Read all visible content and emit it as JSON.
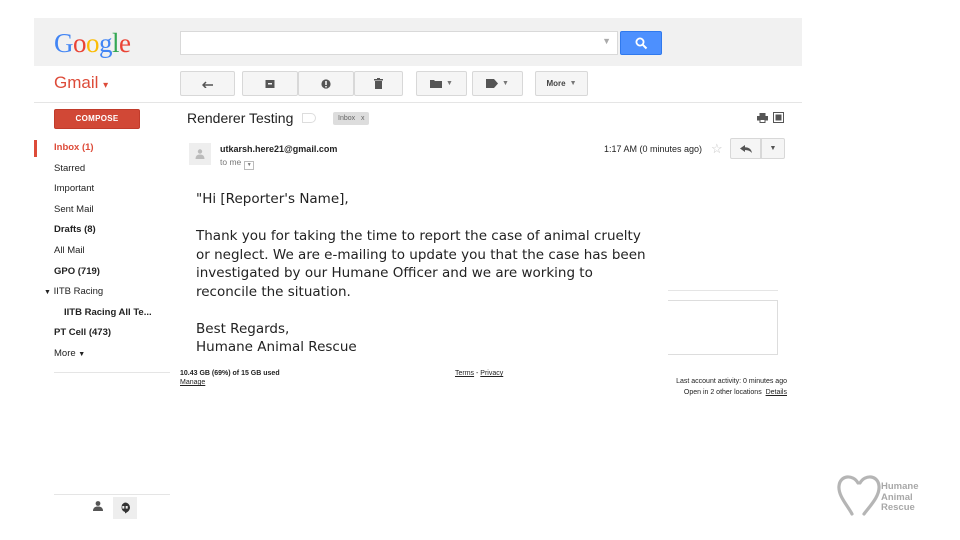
{
  "header": {
    "logo_letters": [
      "G",
      "o",
      "o",
      "g",
      "l",
      "e"
    ],
    "search": {
      "value": "",
      "placeholder": ""
    }
  },
  "app_label": "Gmail",
  "toolbar": {
    "more_label": "More"
  },
  "compose_label": "COMPOSE",
  "nav_items": [
    {
      "label": "Inbox (1)"
    },
    {
      "label": "Starred"
    },
    {
      "label": "Important"
    },
    {
      "label": "Sent Mail"
    },
    {
      "label": "Drafts (8)"
    },
    {
      "label": "All Mail"
    },
    {
      "label": "GPO (719)"
    },
    {
      "label": "IITB Racing"
    },
    {
      "label": "IITB Racing All Te..."
    },
    {
      "label": "PT Cell (473)"
    },
    {
      "label": "More"
    }
  ],
  "message": {
    "subject": "Renderer Testing",
    "label_chip": "Inbox",
    "label_chip_close": "x",
    "sender": "utkarsh.here21@gmail.com",
    "recipient": "to me",
    "time": "1:17 AM (0 minutes ago)",
    "body": {
      "greeting": "\"Hi [Reporter's Name],",
      "paragraph": "Thank you for taking the time to report the case of animal cruelty\nor neglect. We are e-mailing to update you that the case has been\ninvestigated by our Humane Officer and we are working to\nreconcile the situation.",
      "closing": "Best Regards,",
      "signature": "Humane Animal Rescue"
    }
  },
  "footer": {
    "storage": "10.43 GB (69%) of 15 GB used",
    "manage": "Manage",
    "terms": "Terms",
    "separator": " - ",
    "privacy": "Privacy",
    "activity": "Last account activity: 0 minutes ago",
    "open_locations": "Open in 2 other locations",
    "details": "Details"
  },
  "brand_logo": {
    "line1": "Humane",
    "line2": "Animal",
    "line3": "Rescue"
  },
  "colors": {
    "gmail_red": "#dd4b39",
    "compose_red": "#d14836",
    "search_blue": "#4d90fe"
  }
}
